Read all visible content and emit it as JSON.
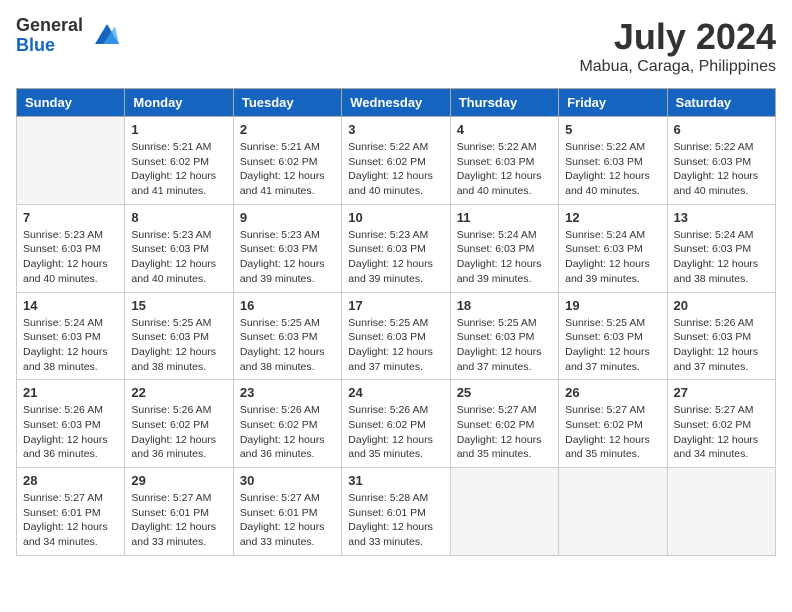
{
  "header": {
    "logo_general": "General",
    "logo_blue": "Blue",
    "month_year": "July 2024",
    "location": "Mabua, Caraga, Philippines"
  },
  "columns": [
    "Sunday",
    "Monday",
    "Tuesday",
    "Wednesday",
    "Thursday",
    "Friday",
    "Saturday"
  ],
  "weeks": [
    [
      {
        "day": "",
        "info": ""
      },
      {
        "day": "1",
        "info": "Sunrise: 5:21 AM\nSunset: 6:02 PM\nDaylight: 12 hours\nand 41 minutes."
      },
      {
        "day": "2",
        "info": "Sunrise: 5:21 AM\nSunset: 6:02 PM\nDaylight: 12 hours\nand 41 minutes."
      },
      {
        "day": "3",
        "info": "Sunrise: 5:22 AM\nSunset: 6:02 PM\nDaylight: 12 hours\nand 40 minutes."
      },
      {
        "day": "4",
        "info": "Sunrise: 5:22 AM\nSunset: 6:03 PM\nDaylight: 12 hours\nand 40 minutes."
      },
      {
        "day": "5",
        "info": "Sunrise: 5:22 AM\nSunset: 6:03 PM\nDaylight: 12 hours\nand 40 minutes."
      },
      {
        "day": "6",
        "info": "Sunrise: 5:22 AM\nSunset: 6:03 PM\nDaylight: 12 hours\nand 40 minutes."
      }
    ],
    [
      {
        "day": "7",
        "info": "Sunrise: 5:23 AM\nSunset: 6:03 PM\nDaylight: 12 hours\nand 40 minutes."
      },
      {
        "day": "8",
        "info": "Sunrise: 5:23 AM\nSunset: 6:03 PM\nDaylight: 12 hours\nand 40 minutes."
      },
      {
        "day": "9",
        "info": "Sunrise: 5:23 AM\nSunset: 6:03 PM\nDaylight: 12 hours\nand 39 minutes."
      },
      {
        "day": "10",
        "info": "Sunrise: 5:23 AM\nSunset: 6:03 PM\nDaylight: 12 hours\nand 39 minutes."
      },
      {
        "day": "11",
        "info": "Sunrise: 5:24 AM\nSunset: 6:03 PM\nDaylight: 12 hours\nand 39 minutes."
      },
      {
        "day": "12",
        "info": "Sunrise: 5:24 AM\nSunset: 6:03 PM\nDaylight: 12 hours\nand 39 minutes."
      },
      {
        "day": "13",
        "info": "Sunrise: 5:24 AM\nSunset: 6:03 PM\nDaylight: 12 hours\nand 38 minutes."
      }
    ],
    [
      {
        "day": "14",
        "info": "Sunrise: 5:24 AM\nSunset: 6:03 PM\nDaylight: 12 hours\nand 38 minutes."
      },
      {
        "day": "15",
        "info": "Sunrise: 5:25 AM\nSunset: 6:03 PM\nDaylight: 12 hours\nand 38 minutes."
      },
      {
        "day": "16",
        "info": "Sunrise: 5:25 AM\nSunset: 6:03 PM\nDaylight: 12 hours\nand 38 minutes."
      },
      {
        "day": "17",
        "info": "Sunrise: 5:25 AM\nSunset: 6:03 PM\nDaylight: 12 hours\nand 37 minutes."
      },
      {
        "day": "18",
        "info": "Sunrise: 5:25 AM\nSunset: 6:03 PM\nDaylight: 12 hours\nand 37 minutes."
      },
      {
        "day": "19",
        "info": "Sunrise: 5:25 AM\nSunset: 6:03 PM\nDaylight: 12 hours\nand 37 minutes."
      },
      {
        "day": "20",
        "info": "Sunrise: 5:26 AM\nSunset: 6:03 PM\nDaylight: 12 hours\nand 37 minutes."
      }
    ],
    [
      {
        "day": "21",
        "info": "Sunrise: 5:26 AM\nSunset: 6:03 PM\nDaylight: 12 hours\nand 36 minutes."
      },
      {
        "day": "22",
        "info": "Sunrise: 5:26 AM\nSunset: 6:02 PM\nDaylight: 12 hours\nand 36 minutes."
      },
      {
        "day": "23",
        "info": "Sunrise: 5:26 AM\nSunset: 6:02 PM\nDaylight: 12 hours\nand 36 minutes."
      },
      {
        "day": "24",
        "info": "Sunrise: 5:26 AM\nSunset: 6:02 PM\nDaylight: 12 hours\nand 35 minutes."
      },
      {
        "day": "25",
        "info": "Sunrise: 5:27 AM\nSunset: 6:02 PM\nDaylight: 12 hours\nand 35 minutes."
      },
      {
        "day": "26",
        "info": "Sunrise: 5:27 AM\nSunset: 6:02 PM\nDaylight: 12 hours\nand 35 minutes."
      },
      {
        "day": "27",
        "info": "Sunrise: 5:27 AM\nSunset: 6:02 PM\nDaylight: 12 hours\nand 34 minutes."
      }
    ],
    [
      {
        "day": "28",
        "info": "Sunrise: 5:27 AM\nSunset: 6:01 PM\nDaylight: 12 hours\nand 34 minutes."
      },
      {
        "day": "29",
        "info": "Sunrise: 5:27 AM\nSunset: 6:01 PM\nDaylight: 12 hours\nand 33 minutes."
      },
      {
        "day": "30",
        "info": "Sunrise: 5:27 AM\nSunset: 6:01 PM\nDaylight: 12 hours\nand 33 minutes."
      },
      {
        "day": "31",
        "info": "Sunrise: 5:28 AM\nSunset: 6:01 PM\nDaylight: 12 hours\nand 33 minutes."
      },
      {
        "day": "",
        "info": ""
      },
      {
        "day": "",
        "info": ""
      },
      {
        "day": "",
        "info": ""
      }
    ]
  ]
}
